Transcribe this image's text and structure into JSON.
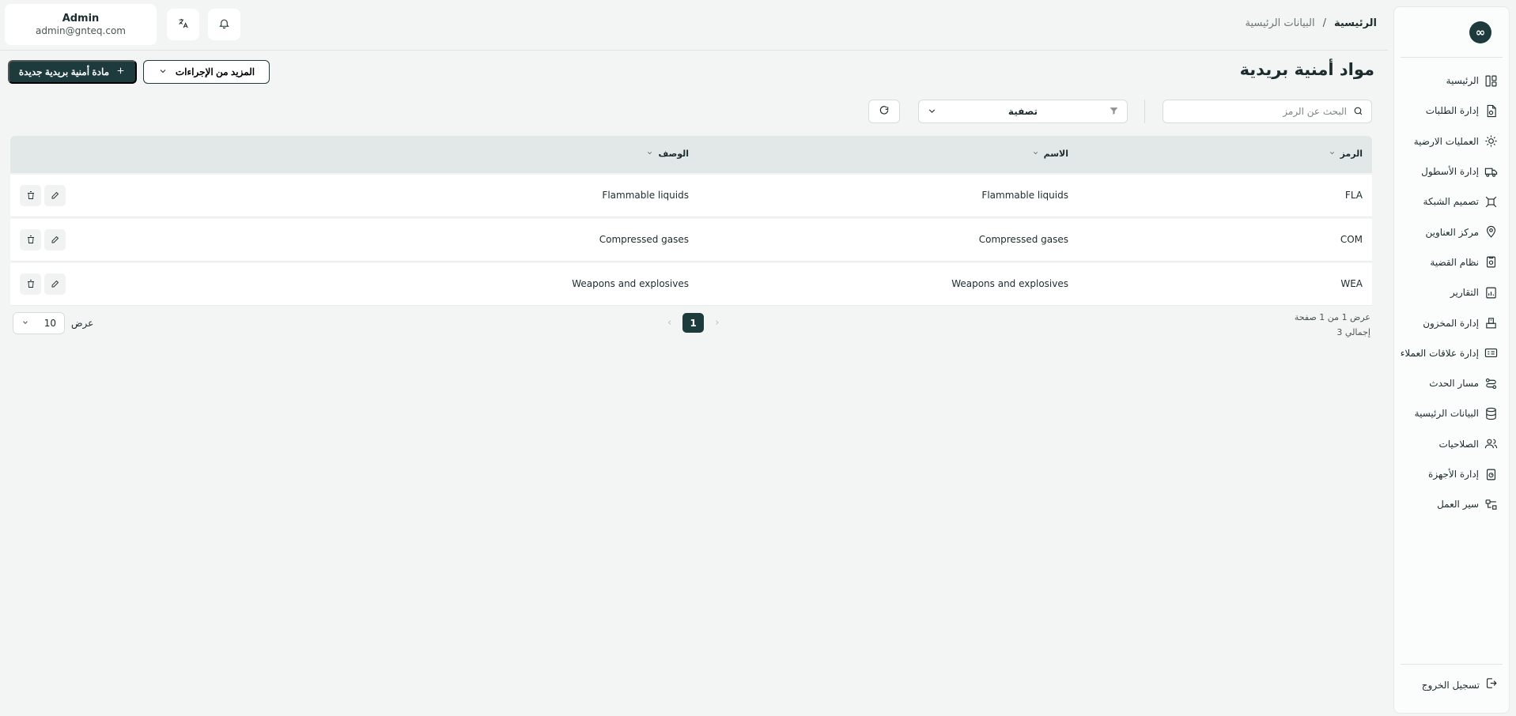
{
  "sidebar": {
    "logo": "∞",
    "items": [
      {
        "label": "الرئيسية",
        "icon": "dashboard-icon"
      },
      {
        "label": "إدارة الطلبات",
        "icon": "orders-icon"
      },
      {
        "label": "العمليات الارضية",
        "icon": "ground-operations-icon"
      },
      {
        "label": "إدارة الأسطول",
        "icon": "truck-icon"
      },
      {
        "label": "تصميم الشبكة",
        "icon": "network-icon"
      },
      {
        "label": "مركز العناوين",
        "icon": "location-icon"
      },
      {
        "label": "نظام القضية",
        "icon": "case-icon"
      },
      {
        "label": "التقارير",
        "icon": "reports-icon"
      },
      {
        "label": "إدارة المخزون",
        "icon": "inventory-icon"
      },
      {
        "label": "إدارة علاقات العملاء",
        "icon": "crm-icon"
      },
      {
        "label": "مسار الحدث",
        "icon": "route-icon"
      },
      {
        "label": "البيانات الرئيسية",
        "icon": "database-icon"
      },
      {
        "label": "الصلاحيات",
        "icon": "users-icon"
      },
      {
        "label": "إدارة الأجهزة",
        "icon": "devices-icon"
      },
      {
        "label": "سير العمل",
        "icon": "workflow-icon"
      }
    ],
    "logout": "تسجيل الخروج"
  },
  "header": {
    "breadcrumb": {
      "home": "الرئيسية",
      "separator": "/",
      "current": "البيانات الرئيسية"
    },
    "user": {
      "name": "Admin",
      "email": "admin@gnteq.com"
    }
  },
  "page": {
    "title": "مواد أمنية بريدية",
    "new_button": "مادة أمنية بريدية جديدة",
    "more_button": "المزيد من الإجراءات",
    "search_placeholder": "البحث عن الرمز",
    "filter_label": "تصفية"
  },
  "table": {
    "columns": [
      "الرمز",
      "الاسم",
      "الوصف"
    ],
    "rows": [
      {
        "code": "FLA",
        "name": "Flammable liquids",
        "description": "Flammable liquids"
      },
      {
        "code": "COM",
        "name": "Compressed gases",
        "description": "Compressed gases"
      },
      {
        "code": "WEA",
        "name": "Weapons and explosives",
        "description": "Weapons and explosives"
      }
    ]
  },
  "pagination": {
    "info": "عرض 1 من 1 صفحة",
    "total": "إجمالي 3",
    "current_page": "1",
    "prev": "‹",
    "next": "›",
    "page_size": "10",
    "show_label": "عرض"
  }
}
